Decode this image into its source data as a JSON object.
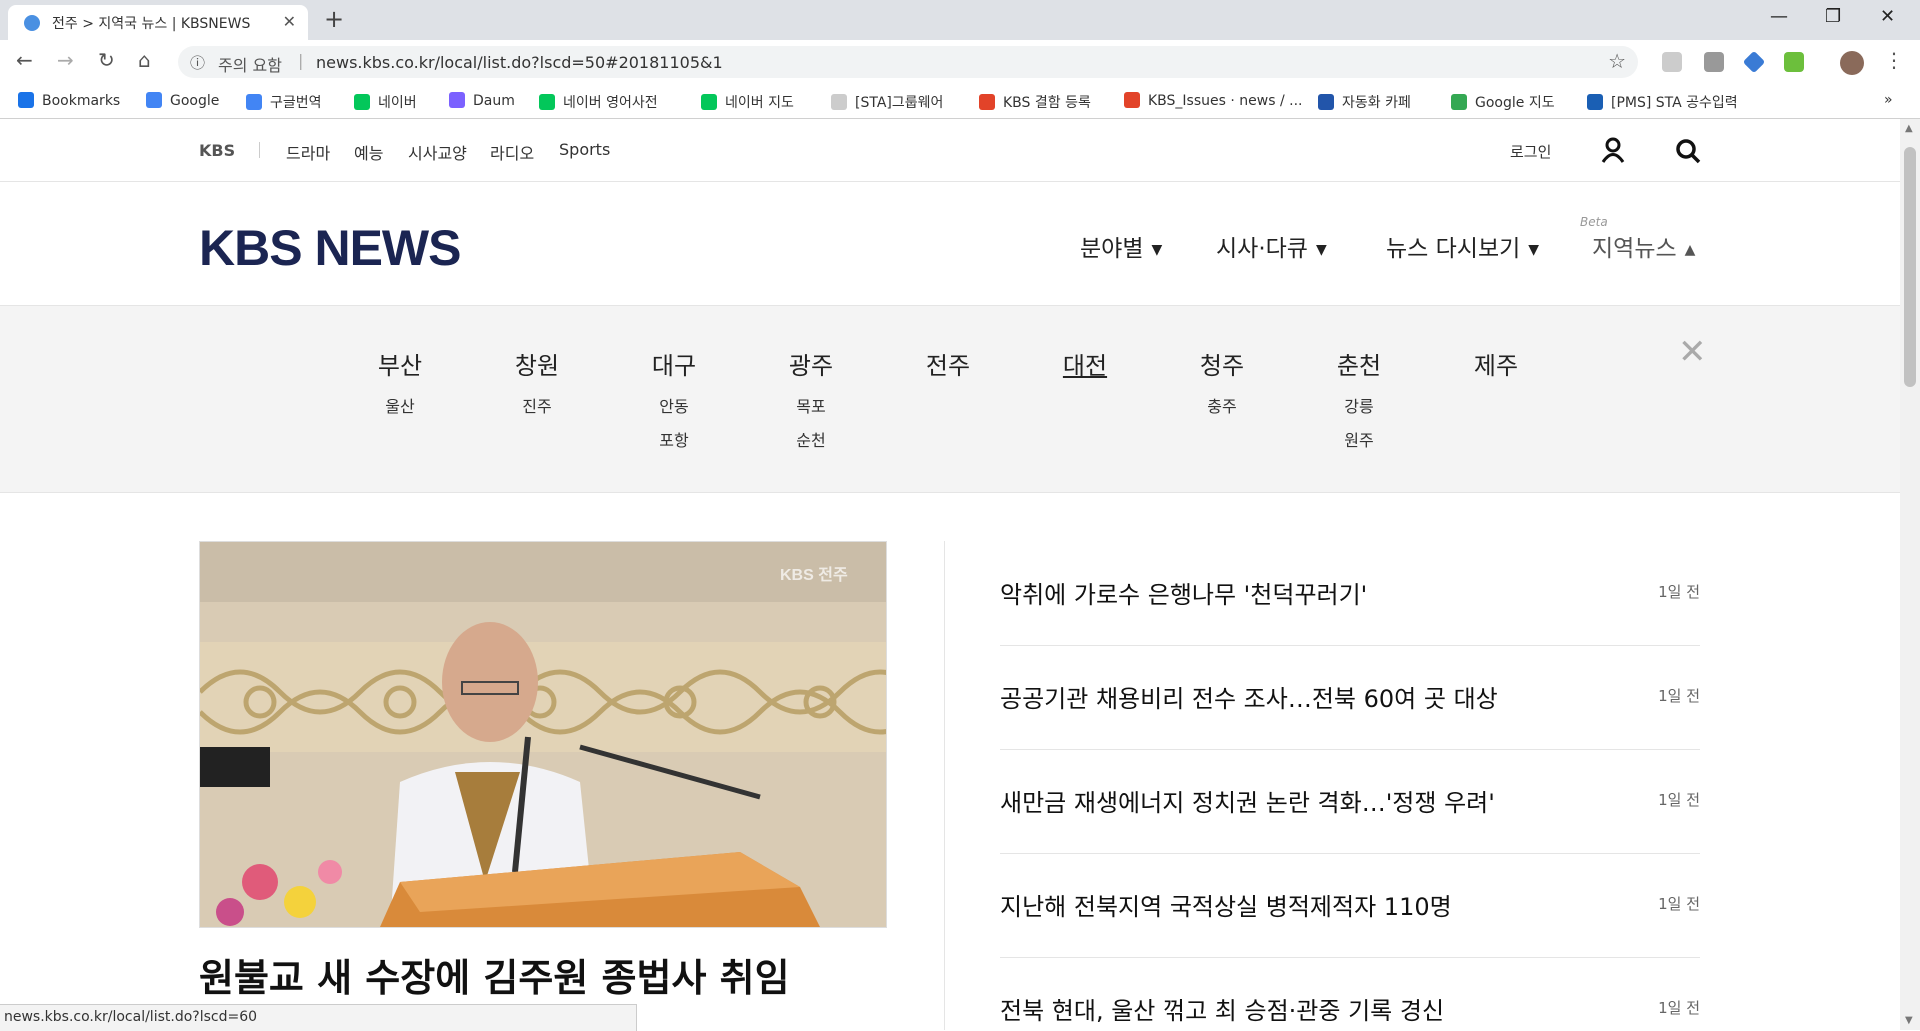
{
  "browser": {
    "tab_title": "전주 > 지역국 뉴스 | KBSNEWS",
    "tab_close": "✕",
    "new_tab": "+",
    "window": {
      "minimize": "—",
      "maximize": "❐",
      "close": "✕"
    },
    "nav": {
      "back": "←",
      "forward": "→",
      "reload": "↻",
      "home": "⌂"
    },
    "security_icon": "ⓘ",
    "security_text": "주의 요함",
    "separator": "|",
    "url": "news.kbs.co.kr/local/list.do?lscd=50#20181105&1",
    "bookmark_star": "☆",
    "menu_dots": "⋮",
    "bookmarks": [
      {
        "label": "Bookmarks",
        "icon": "star-icon",
        "color": "#1a73e8"
      },
      {
        "label": "Google",
        "icon": "google-icon",
        "color": "#4285f4"
      },
      {
        "label": "구글번역",
        "icon": "translate-icon",
        "color": "#4285f4"
      },
      {
        "label": "네이버",
        "icon": "naver-icon",
        "color": "#03c75a"
      },
      {
        "label": "Daum",
        "icon": "daum-icon",
        "color": "#7b61ff"
      },
      {
        "label": "네이버 영어사전",
        "icon": "dict-icon",
        "color": "#03c75a"
      },
      {
        "label": "네이버 지도",
        "icon": "naver-icon",
        "color": "#03c75a"
      },
      {
        "label": "[STA]그룹웨어",
        "icon": "page-icon",
        "color": "#cccccc"
      },
      {
        "label": "KBS 결함 등록",
        "icon": "gitlab-icon",
        "color": "#e24329"
      },
      {
        "label": "KBS_Issues · news / ...",
        "icon": "gitlab-icon",
        "color": "#e24329"
      },
      {
        "label": "자동화 카페",
        "icon": "sta-icon",
        "color": "#2255aa"
      },
      {
        "label": "Google 지도",
        "icon": "maps-icon",
        "color": "#34a853"
      },
      {
        "label": "[PMS] STA 공수입력",
        "icon": "pms-icon",
        "color": "#1a5fb4"
      }
    ],
    "bookmarks_more": "»",
    "status_url": "news.kbs.co.kr/local/list.do?lscd=60"
  },
  "site": {
    "topnav": {
      "brand": "KBS",
      "menu": [
        "드라마",
        "예능",
        "시사교양",
        "라디오",
        "Sports"
      ],
      "login": "로그인"
    },
    "logo": "KBS NEWS",
    "mainmenu": [
      {
        "label": "분야별",
        "arrow": "▼"
      },
      {
        "label": "시사·다큐",
        "arrow": "▼"
      },
      {
        "label": "뉴스 다시보기",
        "arrow": "▼"
      },
      {
        "label": "지역뉴스",
        "arrow": "▲"
      }
    ],
    "beta": "Beta",
    "close_x": "✕",
    "regions": [
      {
        "name": "부산",
        "subs": [
          "울산"
        ]
      },
      {
        "name": "창원",
        "subs": [
          "진주"
        ]
      },
      {
        "name": "대구",
        "subs": [
          "안동",
          "포항"
        ]
      },
      {
        "name": "광주",
        "subs": [
          "목포",
          "순천"
        ]
      },
      {
        "name": "전주",
        "subs": []
      },
      {
        "name": "대전",
        "subs": [],
        "active": true
      },
      {
        "name": "청주",
        "subs": [
          "충주"
        ]
      },
      {
        "name": "춘천",
        "subs": [
          "강릉",
          "원주"
        ]
      },
      {
        "name": "제주",
        "subs": []
      }
    ],
    "feature": {
      "title": "원불교 새 수장에 김주원 종법사 취임",
      "watermark": "KBS 전주"
    },
    "news": [
      {
        "title": "악취에 가로수 은행나무 '천덕꾸러기'",
        "date": "1일 전"
      },
      {
        "title": "공공기관 채용비리 전수 조사…전북 60여 곳 대상",
        "date": "1일 전"
      },
      {
        "title": "새만금 재생에너지 정치권 논란 격화…'정쟁 우려'",
        "date": "1일 전"
      },
      {
        "title": "지난해 전북지역 국적상실 병적제적자 110명",
        "date": "1일 전"
      },
      {
        "title": "전북 현대, 울산 꺾고 최 승점·관중 기록 경신",
        "date": "1일 전"
      }
    ]
  }
}
